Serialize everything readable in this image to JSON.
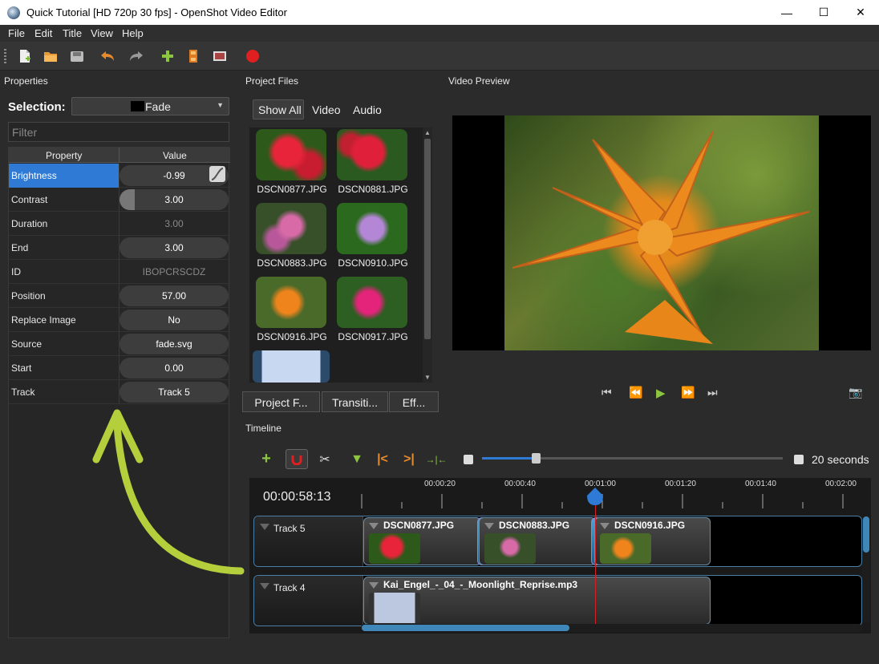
{
  "window": {
    "title": "Quick Tutorial [HD 720p 30 fps] - OpenShot Video Editor",
    "minimize": "—",
    "maximize": "☐",
    "close": "✕"
  },
  "menu": [
    "File",
    "Edit",
    "Title",
    "View",
    "Help"
  ],
  "panels": {
    "properties": "Properties",
    "project_files": "Project Files",
    "video_preview": "Video Preview",
    "timeline": "Timeline"
  },
  "selection": {
    "label": "Selection:",
    "value": "Fade"
  },
  "filter": {
    "placeholder": "Filter"
  },
  "props_table": {
    "col_property": "Property",
    "col_value": "Value",
    "rows": [
      {
        "name": "Brightness",
        "value": "-0.99"
      },
      {
        "name": "Contrast",
        "value": "3.00"
      },
      {
        "name": "Duration",
        "value": "3.00"
      },
      {
        "name": "End",
        "value": "3.00"
      },
      {
        "name": "ID",
        "value": "IBOPCRSCDZ"
      },
      {
        "name": "Position",
        "value": "57.00"
      },
      {
        "name": "Replace Image",
        "value": "No"
      },
      {
        "name": "Source",
        "value": "fade.svg"
      },
      {
        "name": "Start",
        "value": "0.00"
      },
      {
        "name": "Track",
        "value": "Track 5"
      }
    ]
  },
  "file_tabs": [
    "Show All",
    "Video",
    "Audio"
  ],
  "files": [
    "DSCN0877.JPG",
    "DSCN0881.JPG",
    "DSCN0883.JPG",
    "DSCN0910.JPG",
    "DSCN0916.JPG",
    "DSCN0917.JPG"
  ],
  "bottom_tabs": [
    "Project F...",
    "Transiti...",
    "Eff..."
  ],
  "timeline": {
    "zoom_label": "20 seconds",
    "current_time": "00:00:58:13",
    "ticks": [
      "00:00:20",
      "00:00:40",
      "00:01:00",
      "00:01:20",
      "00:01:40",
      "00:02:00"
    ],
    "tracks": [
      {
        "name": "Track 5",
        "clips": [
          "DSCN0877.JPG",
          "DSCN0883.JPG",
          "DSCN0916.JPG"
        ]
      },
      {
        "name": "Track 4",
        "clips": [
          "Kai_Engel_-_04_-_Moonlight_Reprise.mp3"
        ]
      }
    ]
  },
  "colors": {
    "accent": "#2f7ad4",
    "arrow": "#b5cf3c",
    "clip_border": "#6a8fa8",
    "playhead": "#d42020"
  }
}
